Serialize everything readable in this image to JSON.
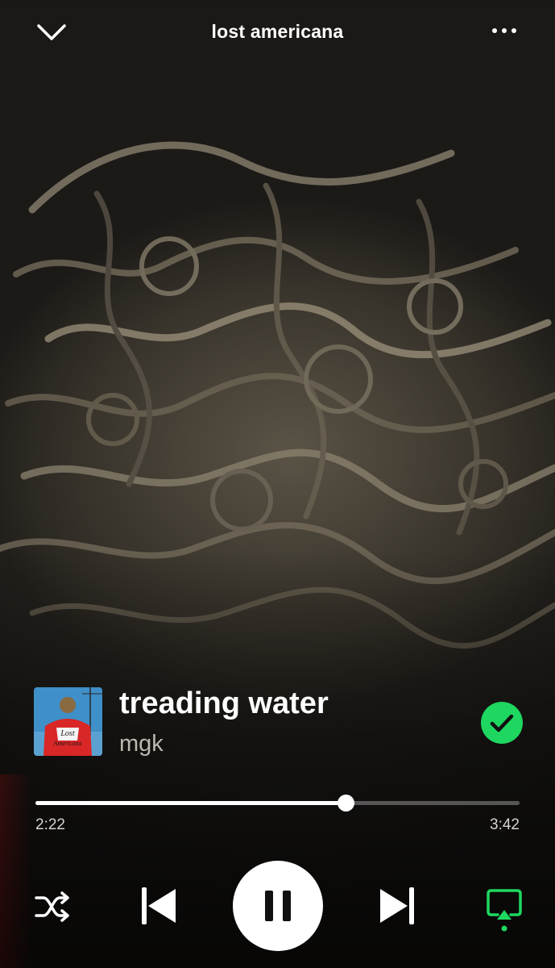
{
  "header": {
    "context_title": "lost americana",
    "collapse_icon": "chevron-down-icon",
    "more_icon": "more-options-icon"
  },
  "track": {
    "title": "treading water",
    "artist": "mgk",
    "album_art_text_line1": "Lost",
    "album_art_text_line2": "Americana",
    "saved": true
  },
  "progress": {
    "elapsed": "2:22",
    "duration": "3:42",
    "fraction": 0.64
  },
  "controls": {
    "shuffle_icon": "shuffle-icon",
    "previous_icon": "skip-previous-icon",
    "play_pause_icon": "pause-icon",
    "next_icon": "skip-next-icon",
    "repeat_icon": "device-connect-icon"
  },
  "colors": {
    "accent": "#1ed760",
    "text_primary": "#ffffff",
    "text_secondary": "#bdb8b0"
  }
}
